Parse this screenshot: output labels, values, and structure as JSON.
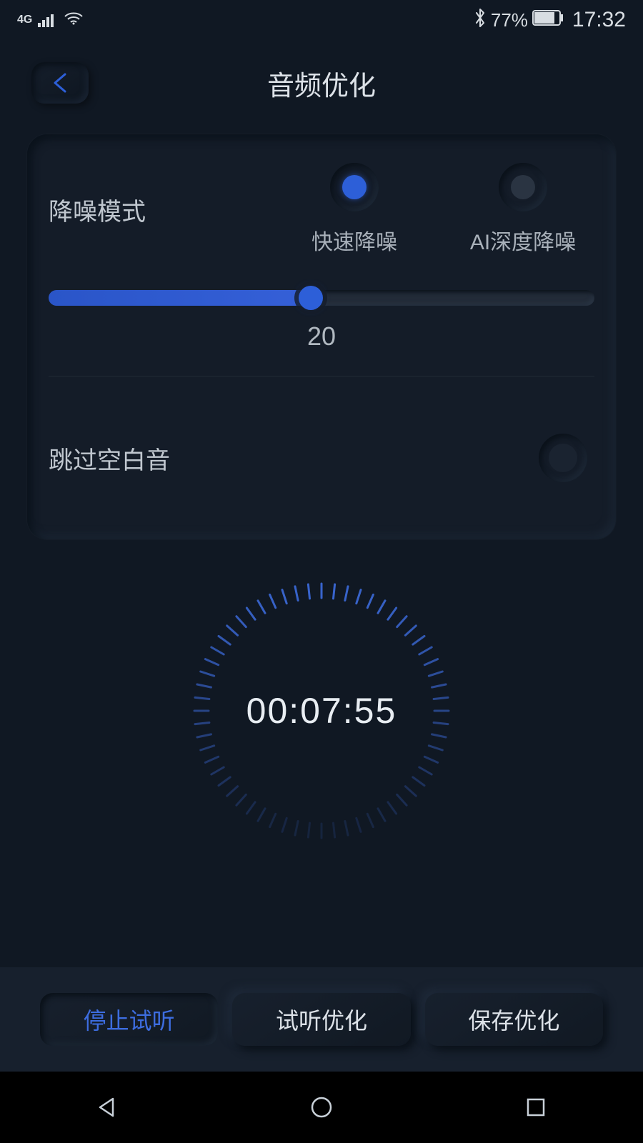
{
  "status": {
    "network": "4G",
    "battery_pct": "77%",
    "time": "17:32"
  },
  "header": {
    "title": "音频优化"
  },
  "noise": {
    "label": "降噪模式",
    "opt_fast": "快速降噪",
    "opt_ai": "AI深度降噪",
    "selected": "fast",
    "slider_value": "20"
  },
  "skip_silence": {
    "label": "跳过空白音",
    "enabled": false
  },
  "timer": {
    "display": "00:07:55"
  },
  "actions": {
    "stop": "停止试听",
    "preview": "试听优化",
    "save": "保存优化"
  }
}
